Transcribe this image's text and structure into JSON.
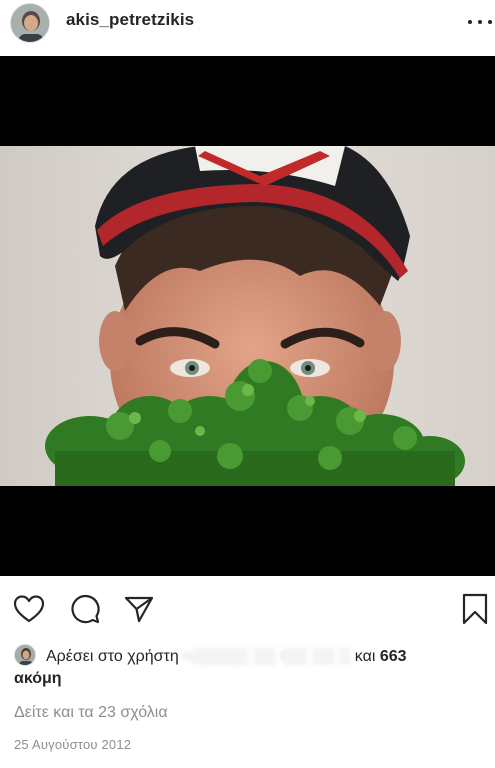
{
  "post": {
    "username": "akis_petretzikis",
    "more_icon": "more-horizontal-icon",
    "photo_description_icon": "photo"
  },
  "actions": {
    "like_icon": "heart-icon",
    "comment_icon": "comment-icon",
    "share_icon": "share-icon",
    "save_icon": "bookmark-icon"
  },
  "likes": {
    "prefix": "Αρέσει στο χρήστη",
    "blurred_user": "n▒▒▒▒▒ ▒▒ t▒▒ ▒▒ ▒",
    "and_label": "και",
    "count": "663",
    "suffix": "ακόμη"
  },
  "comments": {
    "view_all": "Δείτε και τα 23 σχόλια"
  },
  "timestamp": "25 Αυγούστου 2012"
}
